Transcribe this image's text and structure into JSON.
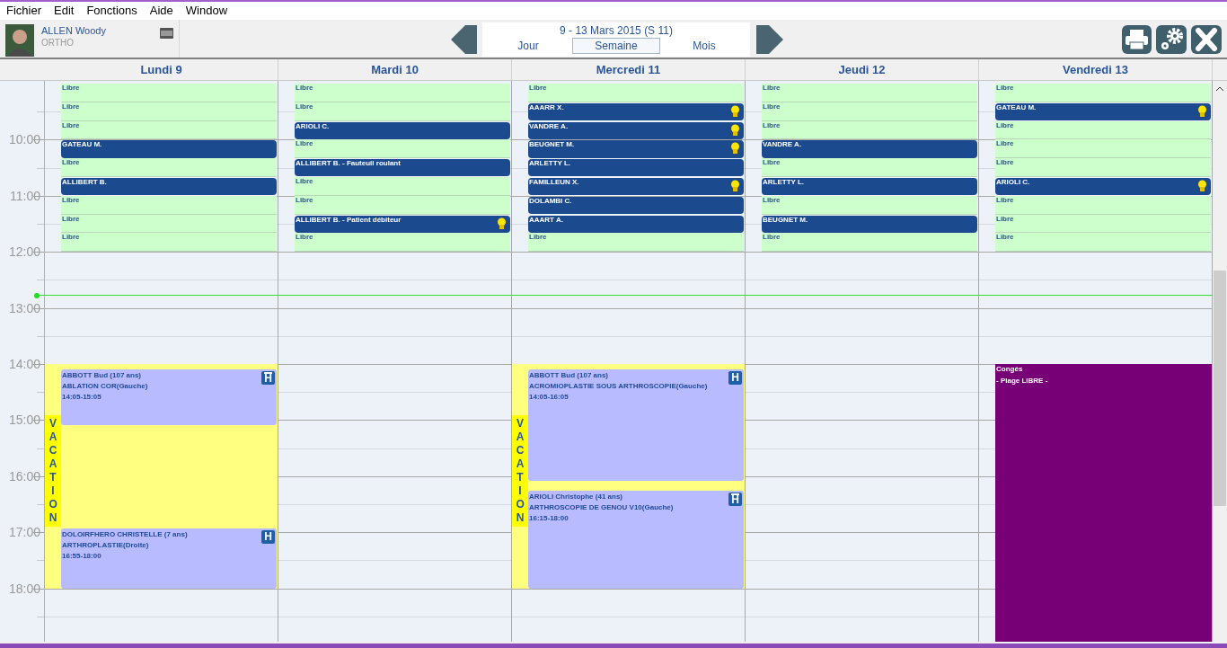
{
  "menu": [
    "Fichier",
    "Edit",
    "Fonctions",
    "Aide",
    "Window"
  ],
  "user": {
    "name": "ALLEN Woody",
    "role": "ORTHO"
  },
  "period": {
    "title": "9 - 13 Mars 2015 (S 11)",
    "views": [
      {
        "label": "Jour",
        "selected": false
      },
      {
        "label": "Semaine",
        "selected": true
      },
      {
        "label": "Mois",
        "selected": false
      }
    ]
  },
  "hours": [
    "10:00",
    "11:00",
    "12:00",
    "13:00",
    "14:00",
    "15:00",
    "16:00",
    "17:00",
    "18:00"
  ],
  "days": [
    {
      "label": "Lundi 9",
      "slots": [
        {
          "kind": "free",
          "text": "Libre",
          "alert": false
        },
        {
          "kind": "free",
          "text": "Libre",
          "alert": false
        },
        {
          "kind": "free",
          "text": "Libre",
          "alert": false
        },
        {
          "kind": "booked",
          "text": "GATEAU M.",
          "alert": false
        },
        {
          "kind": "free",
          "text": "Libre",
          "alert": false
        },
        {
          "kind": "booked",
          "text": "ALLIBERT B.",
          "alert": false
        },
        {
          "kind": "free",
          "text": "Libre",
          "alert": false
        },
        {
          "kind": "free",
          "text": "Libre",
          "alert": false
        },
        {
          "kind": "free",
          "text": "Libre",
          "alert": false
        }
      ],
      "blocks": [
        {
          "kind": "vacation",
          "label": "VACATION",
          "events": [
            {
              "lines": [
                "ABBOTT Bud (107 ans)",
                "ABLATION COR(Gauche)",
                "14:05-15:05"
              ],
              "badge": "H",
              "badge_roof": true
            },
            {
              "lines": [
                "DOLOIRFHERO CHRISTELLE (7 ans)",
                "ARTHROPLASTIE(Droite)",
                "16:55-18:00"
              ],
              "badge": "H",
              "badge_roof": false
            }
          ]
        }
      ]
    },
    {
      "label": "Mardi 10",
      "slots": [
        {
          "kind": "free",
          "text": "Libre",
          "alert": false
        },
        {
          "kind": "free",
          "text": "Libre",
          "alert": false
        },
        {
          "kind": "booked",
          "text": "ARIOLI C.",
          "alert": false
        },
        {
          "kind": "free",
          "text": "Libre",
          "alert": false
        },
        {
          "kind": "booked",
          "text": "ALLIBERT B. - Fauteuil roulant",
          "alert": false
        },
        {
          "kind": "free",
          "text": "Libre",
          "alert": false
        },
        {
          "kind": "free",
          "text": "Libre",
          "alert": false
        },
        {
          "kind": "booked",
          "text": "ALLIBERT B. - Patient débiteur",
          "alert": true
        },
        {
          "kind": "free",
          "text": "Libre",
          "alert": false
        }
      ]
    },
    {
      "label": "Mercredi 11",
      "slots": [
        {
          "kind": "free",
          "text": "Libre",
          "alert": false
        },
        {
          "kind": "booked",
          "text": "AAARR X.",
          "alert": true
        },
        {
          "kind": "booked",
          "text": "VANDRE A.",
          "alert": true
        },
        {
          "kind": "booked",
          "text": "BEUGNET M.",
          "alert": true
        },
        {
          "kind": "booked",
          "text": "ARLETTY L.",
          "alert": false
        },
        {
          "kind": "booked",
          "text": "FAMILLEUN X.",
          "alert": true
        },
        {
          "kind": "booked",
          "text": "DOLAMBI C.",
          "alert": false
        },
        {
          "kind": "booked",
          "text": "AAART A.",
          "alert": false
        },
        {
          "kind": "free",
          "text": "Libre",
          "alert": false
        }
      ],
      "blocks": [
        {
          "kind": "vacation",
          "label": "VACATION",
          "events": [
            {
              "lines": [
                "ABBOTT Bud (107 ans)",
                "ACROMIOPLASTIE SOUS ARTHROSCOPIE(Gauche)",
                "14:05-16:05"
              ],
              "badge": "H",
              "badge_roof": false
            },
            {
              "lines": [
                "ARIOLI Christophe (41 ans)",
                "ARTHROSCOPIE DE GENOU V10(Gauche)",
                "16:15-18:00"
              ],
              "badge": "H",
              "badge_roof": true
            }
          ]
        }
      ]
    },
    {
      "label": "Jeudi 12",
      "slots": [
        {
          "kind": "free",
          "text": "Libre",
          "alert": false
        },
        {
          "kind": "free",
          "text": "Libre",
          "alert": false
        },
        {
          "kind": "free",
          "text": "Libre",
          "alert": false
        },
        {
          "kind": "booked",
          "text": "VANDRE A.",
          "alert": false
        },
        {
          "kind": "free",
          "text": "Libre",
          "alert": false
        },
        {
          "kind": "booked",
          "text": "ARLETTY L.",
          "alert": false
        },
        {
          "kind": "free",
          "text": "Libre",
          "alert": false
        },
        {
          "kind": "booked",
          "text": "BEUGNET M.",
          "alert": false
        },
        {
          "kind": "free",
          "text": "Libre",
          "alert": false
        }
      ]
    },
    {
      "label": "Vendredi 13",
      "slots": [
        {
          "kind": "free",
          "text": "Libre",
          "alert": false
        },
        {
          "kind": "booked",
          "text": "GATEAU M.",
          "alert": true
        },
        {
          "kind": "free",
          "text": "Libre",
          "alert": false
        },
        {
          "kind": "free",
          "text": "Libre",
          "alert": false
        },
        {
          "kind": "free",
          "text": "Libre",
          "alert": false
        },
        {
          "kind": "booked",
          "text": "ARIOLI C.",
          "alert": true
        },
        {
          "kind": "free",
          "text": "Libre",
          "alert": false
        },
        {
          "kind": "free",
          "text": "Libre",
          "alert": false
        },
        {
          "kind": "free",
          "text": "Libre",
          "alert": false
        }
      ],
      "blocks": [
        {
          "kind": "leave",
          "title": "Congés",
          "note": "- Plage LIBRE -"
        }
      ]
    }
  ]
}
